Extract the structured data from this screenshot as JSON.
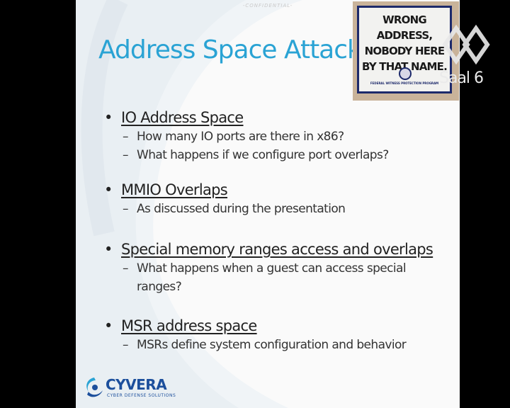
{
  "slide": {
    "confidential": "-CONFIDENTIAL-",
    "title": "Address Space Attacks",
    "bullets": [
      {
        "text": "IO Address Space",
        "subs": [
          "How many IO ports are there in x86?",
          "What happens if we configure port overlaps?"
        ]
      },
      {
        "text": "MMIO Overlaps",
        "subs": [
          "As discussed during the presentation"
        ]
      },
      {
        "text": "Special memory ranges access and overlaps",
        "subs": [
          "What happens when a guest can access special ranges?"
        ]
      },
      {
        "text": "MSR address space",
        "subs": [
          "MSRs define system configuration and behavior"
        ]
      }
    ],
    "bullet_marker": "•",
    "sub_marker": "–"
  },
  "photo": {
    "sign_text": "WRONG ADDRESS, NOBODY HERE BY THAT NAME.",
    "sign_small": "FEDERAL WITNESS PROTECTION PROGRAM"
  },
  "overlay": {
    "room": "Saal 6"
  },
  "brand": {
    "name": "CYVERA",
    "tagline": "CYBER DEFENSE SOLUTIONS"
  },
  "colors": {
    "title": "#2aa3d4",
    "brand": "#1c4f9c",
    "sign_border": "#1d2a6b"
  }
}
